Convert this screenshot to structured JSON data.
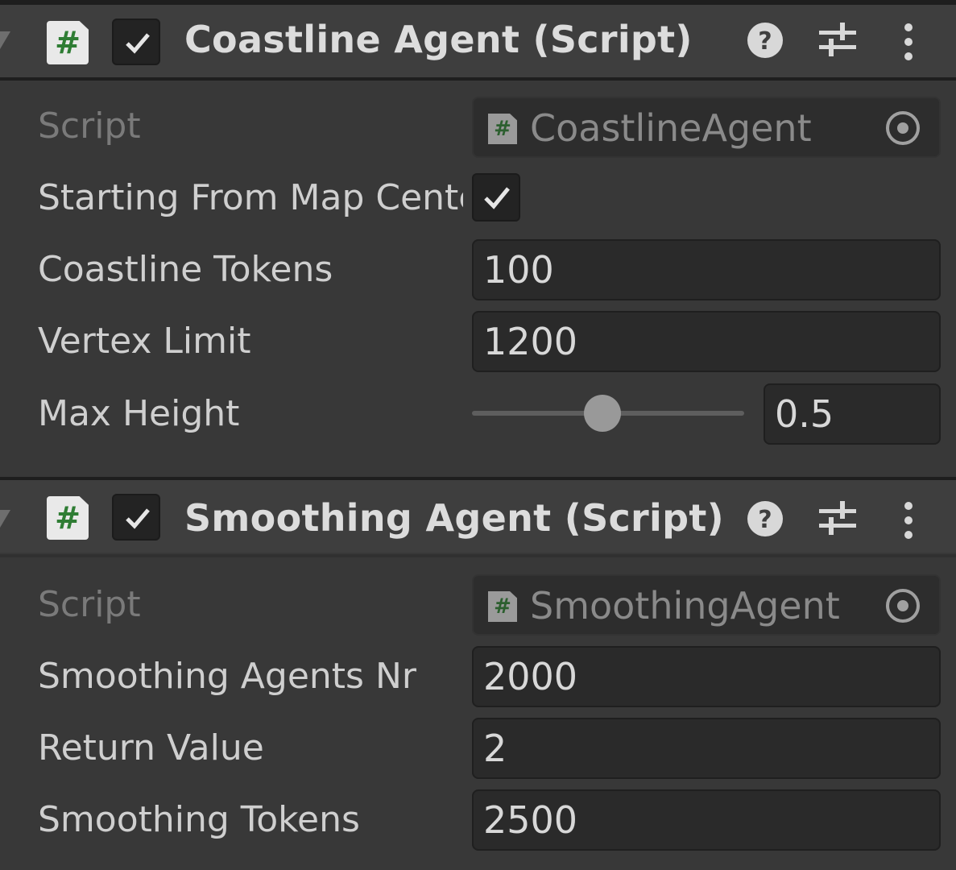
{
  "components": [
    {
      "title": "Coastline Agent (Script)",
      "enabled": true,
      "script_icon": "csharp-script-icon",
      "script_field": {
        "label": "Script",
        "value": "CoastlineAgent"
      },
      "fields": {
        "starting_from_map_center": {
          "label": "Starting From Map Center",
          "checked": true
        },
        "coastline_tokens": {
          "label": "Coastline Tokens",
          "value": "100"
        },
        "vertex_limit": {
          "label": "Vertex Limit",
          "value": "1200"
        },
        "max_height": {
          "label": "Max Height",
          "value": "0.5",
          "slider_fraction": 0.48
        }
      }
    },
    {
      "title": "Smoothing Agent (Script)",
      "enabled": true,
      "script_icon": "csharp-script-icon",
      "script_field": {
        "label": "Script",
        "value": "SmoothingAgent"
      },
      "fields": {
        "smoothing_agents_nr": {
          "label": "Smoothing Agents Nr",
          "value": "2000"
        },
        "return_value": {
          "label": "Return Value",
          "value": "2"
        },
        "smoothing_tokens": {
          "label": "Smoothing Tokens",
          "value": "2500"
        }
      }
    }
  ],
  "header_icons": [
    "help-icon",
    "presets-icon",
    "more-options-icon"
  ],
  "colors": {
    "background": "#383838",
    "header": "#3e3e3e",
    "field": "#2a2a2a",
    "script_green": "#2f7d34"
  }
}
